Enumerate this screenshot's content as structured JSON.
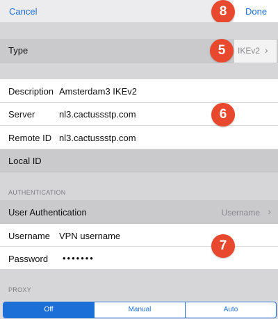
{
  "nav": {
    "cancel": "Cancel",
    "done": "Done"
  },
  "type_row": {
    "label": "Type",
    "value": "IKEv2"
  },
  "fields": {
    "description": {
      "label": "Description",
      "value": "Amsterdam3 IKEv2"
    },
    "server": {
      "label": "Server",
      "value": "nl3.cactussstp.com"
    },
    "remote_id": {
      "label": "Remote ID",
      "value": "nl3.cactussstp.com"
    },
    "local_id": {
      "label": "Local ID"
    }
  },
  "auth": {
    "header": "AUTHENTICATION",
    "user_auth_label": "User Authentication",
    "user_auth_value": "Username",
    "username_label": "Username",
    "username_value": "VPN username",
    "password_label": "Password",
    "password_value": "•••••••"
  },
  "proxy": {
    "header": "PROXY",
    "options": [
      "Off",
      "Manual",
      "Auto"
    ],
    "selected": "Off"
  },
  "badges": {
    "b5": "5",
    "b6": "6",
    "b7": "7",
    "b8": "8"
  },
  "icons": {
    "disclosure": "chevron-right-icon"
  },
  "colors": {
    "accent": "#1c6fd6",
    "badge": "#e8492e"
  }
}
